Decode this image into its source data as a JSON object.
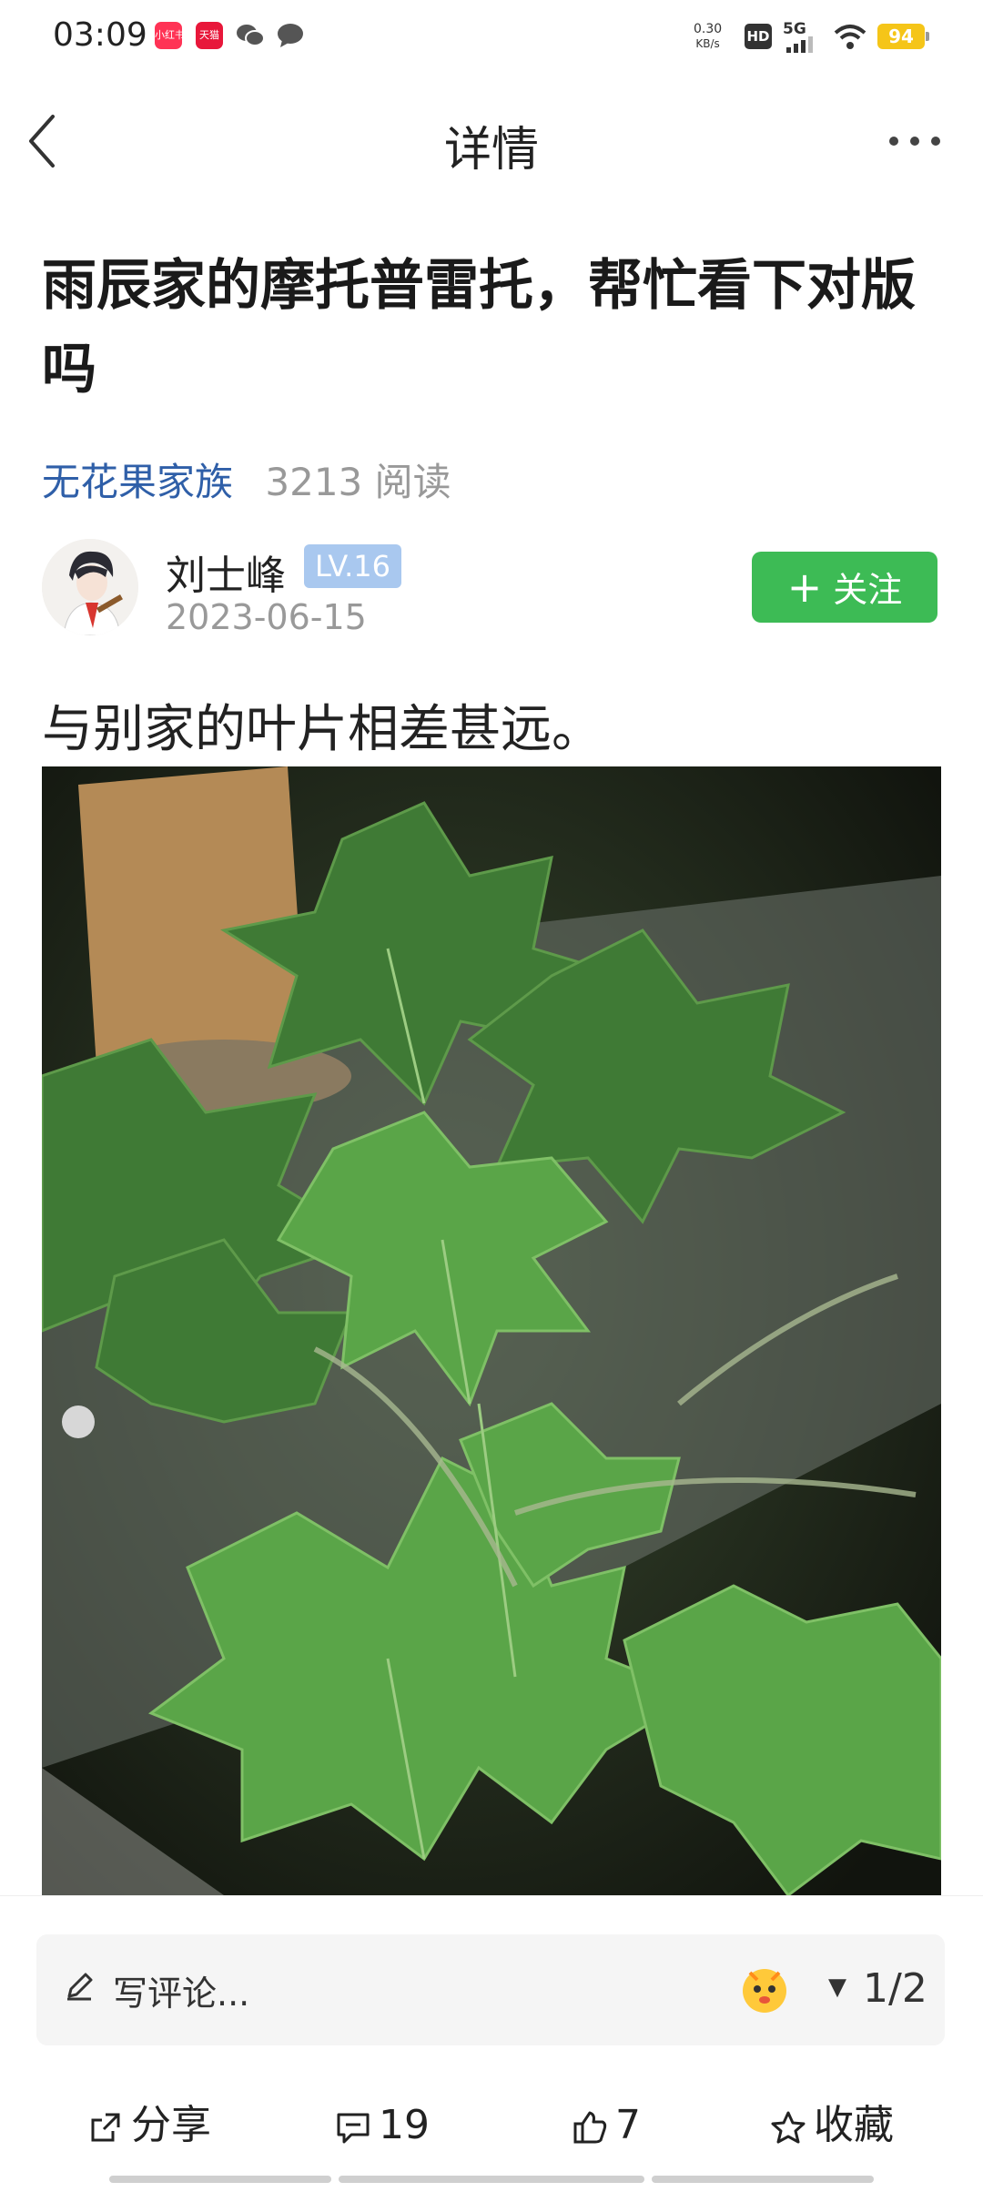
{
  "status_bar": {
    "time": "03:09",
    "app_icon_1": "小红书",
    "app_icon_2": "天猫",
    "net_speed_value": "0.30",
    "net_speed_unit": "KB/s",
    "hd": "HD",
    "network": "5G",
    "battery": "94"
  },
  "nav": {
    "title": "详情"
  },
  "post": {
    "title": "雨辰家的摩托普雷托，帮忙看下对版吗",
    "circle": "无花果家族",
    "views": "3213 阅读",
    "author": {
      "name": "刘士峰",
      "level": "LV.16",
      "date": "2023-06-15"
    },
    "follow_label": "关注",
    "body": "与别家的叶片相差甚远。"
  },
  "bottom": {
    "comment_placeholder": "写评论...",
    "page_indicator": "1/2",
    "share_label": "分享",
    "comment_count": "19",
    "like_count": "7",
    "favorite_label": "收藏"
  },
  "colors": {
    "follow_green": "#3dbb55",
    "circle_blue": "#2f5fa8",
    "level_badge": "#a9c8ef",
    "battery_yellow": "#f5c518"
  }
}
